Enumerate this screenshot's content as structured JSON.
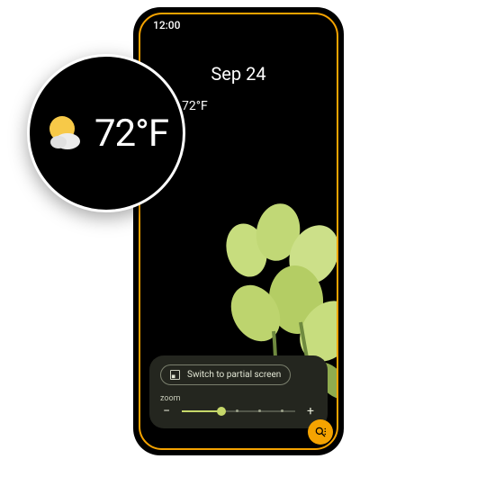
{
  "status": {
    "time": "12:00"
  },
  "date": {
    "display": "Sep 24"
  },
  "weather": {
    "temp": "72°F"
  },
  "magnifier": {
    "switch_label": "Switch to partial screen",
    "zoom_label": "zoom",
    "minus": "−",
    "plus": "+",
    "slider_percent": 35
  },
  "colors": {
    "accent_orange": "#f5a300",
    "accent_lime": "#c6d86a"
  }
}
